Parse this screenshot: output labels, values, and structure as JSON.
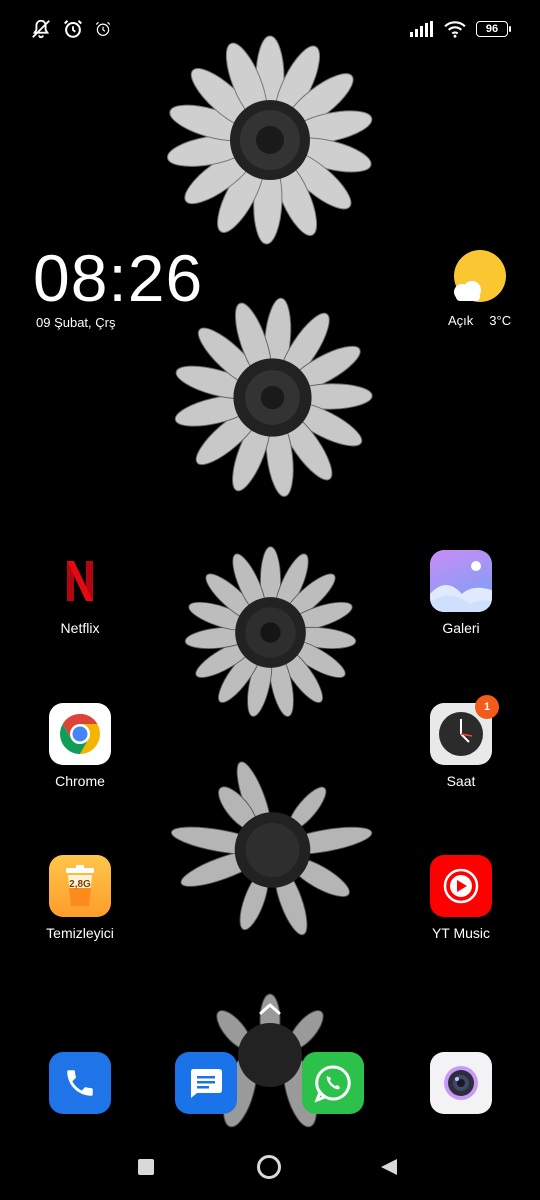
{
  "status_bar": {
    "battery_level": "96",
    "icons_left": [
      "notifications-muted-icon",
      "alarm-icon",
      "alarm-outline-icon"
    ],
    "icons_right": [
      "signal-icon",
      "wifi-icon",
      "battery-icon"
    ]
  },
  "clock_widget": {
    "time": "08:26",
    "date": "09 Şubat, Çrş"
  },
  "weather_widget": {
    "condition": "Açık",
    "temperature": "3°C",
    "icon": "sun-cloud-icon"
  },
  "apps": {
    "netflix": {
      "label": "Netflix",
      "color": "#e50914"
    },
    "gallery": {
      "label": "Galeri"
    },
    "chrome": {
      "label": "Chrome"
    },
    "clock": {
      "label": "Saat",
      "badge": "1"
    },
    "cleaner": {
      "label": "Temizleyici",
      "storage": "2,8G"
    },
    "yt_music": {
      "label": "YT Music",
      "color": "#ff0000"
    }
  },
  "dock": {
    "apps": [
      "phone-icon",
      "messages-icon",
      "whatsapp-icon",
      "camera-icon"
    ]
  },
  "navigation": {
    "buttons": [
      "recents-button",
      "home-button",
      "back-button"
    ]
  }
}
